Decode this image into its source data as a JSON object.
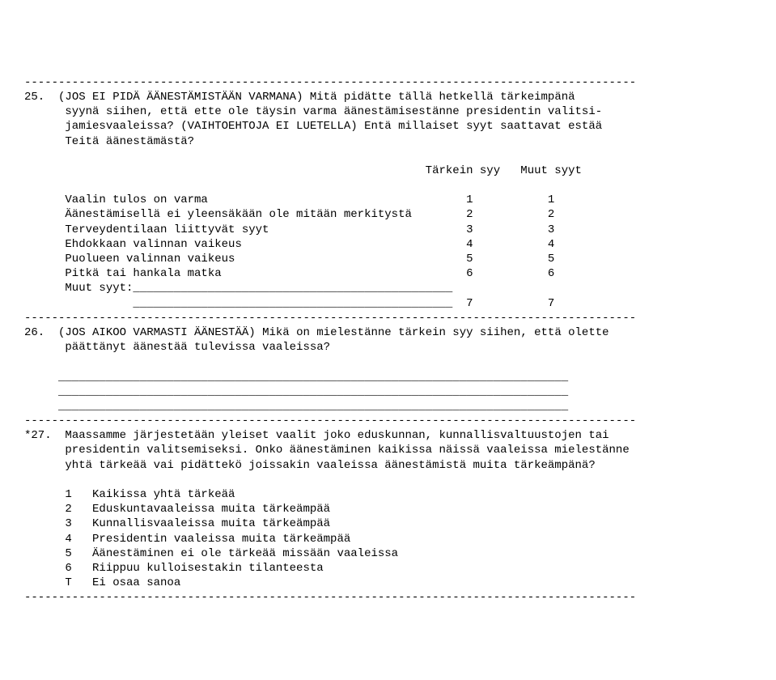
{
  "sep": "------------------------------------------------------------------------------------------",
  "q25": {
    "num": "25.",
    "line1": "  (JOS EI PIDÄ ÄÄNESTÄMISTÄÄN VARMANA) Mitä pidätte tällä hetkellä tärkeimpänä",
    "line2": "      syynä siihen, että ette ole täysin varma äänestämisestänne presidentin valitsi-",
    "line3": "      jamiesvaaleissa? (VAIHTOEHTOJA EI LUETELLA) Entä millaiset syyt saattavat estää",
    "line4": "      Teitä äänestämästä?",
    "colhead": "                                                           Tärkein syy   Muut syyt",
    "rows": [
      {
        "label": "      Vaalin tulos on varma                                      1           1"
      },
      {
        "label": "      Äänestämisellä ei yleensäkään ole mitään merkitystä        2           2"
      },
      {
        "label": "      Terveydentilaan liittyvät syyt                             3           3"
      },
      {
        "label": "      Ehdokkaan valinnan vaikeus                                 4           4"
      },
      {
        "label": "      Puolueen valinnan vaikeus                                  5           5"
      },
      {
        "label": "      Pitkä tai hankala matka                                    6           6"
      },
      {
        "label": "      Muut syyt:_______________________________________________"
      },
      {
        "label": "                _______________________________________________  7           7"
      }
    ]
  },
  "q26": {
    "num": "26.",
    "line1": "  (JOS AIKOO VARMASTI ÄÄNESTÄÄ) Mikä on mielestänne tärkein syy siihen, että olette",
    "line2": "      päättänyt äänestää tulevissa vaaleissa?",
    "blank": "     ___________________________________________________________________________"
  },
  "q27": {
    "num": "*27.",
    "line1": "  Maassamme järjestetään yleiset vaalit joko eduskunnan, kunnallisvaltuustojen tai",
    "line2": "      presidentin valitsemiseksi. Onko äänestäminen kaikissa näissä vaaleissa mielestänne",
    "line3": "      yhtä tärkeää vai pidättekö joissakin vaaleissa äänestämistä muita tärkeämpänä?",
    "opts": [
      "      1   Kaikissa yhtä tärkeää",
      "      2   Eduskuntavaaleissa muita tärkeämpää",
      "      3   Kunnallisvaaleissa muita tärkeämpää",
      "      4   Presidentin vaaleissa muita tärkeämpää",
      "      5   Äänestäminen ei ole tärkeää missään vaaleissa",
      "      6   Riippuu kulloisestakin tilanteesta",
      "      T   Ei osaa sanoa"
    ]
  }
}
